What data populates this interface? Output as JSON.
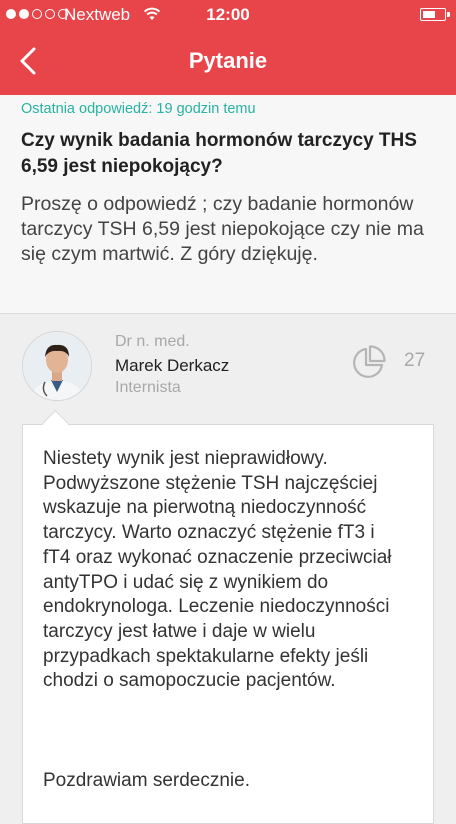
{
  "status_bar": {
    "carrier": "Nextweb",
    "time": "12:00",
    "signal_bars_filled": 2,
    "signal_bars_total": 5
  },
  "nav": {
    "back_icon": "chevron-left-icon",
    "title": "Pytanie"
  },
  "question": {
    "last_answer": "Ostatnia odpowiedź: 19 godzin temu",
    "title": "Czy wynik badania hormonów tarczycy THS 6,59 jest niepokojący?",
    "body": "Proszę o odpowiedź ; czy badanie hormonów tarczycy TSH 6,59 jest niepokojące czy nie ma się czym martwić. Z góry dziękuję."
  },
  "doctor": {
    "degree": "Dr n. med.",
    "name": "Marek Derkacz",
    "specialty": "Internista",
    "stats_icon": "pie-chart-icon",
    "count": "27"
  },
  "answer": {
    "body": "Niestety wynik jest nieprawidłowy. Podwyższone stężenie TSH najczęściej wskazuje na pierwotną niedoczynność tarczycy. Warto oznaczyć stężenie fT3 i fT4 oraz wykonać oznaczenie przeciwciał antyTPO i udać się z wynikiem do endokrynologa. Leczenie niedoczynności tarczycy jest  łatwe i daje w wielu przypadkach spektakularne efekty jeśli chodzi o samopoczucie pacjentów.",
    "greeting": "Pozdrawiam serdecznie."
  },
  "colors": {
    "brand": "#e8454b",
    "accent_teal": "#27b3a3"
  }
}
